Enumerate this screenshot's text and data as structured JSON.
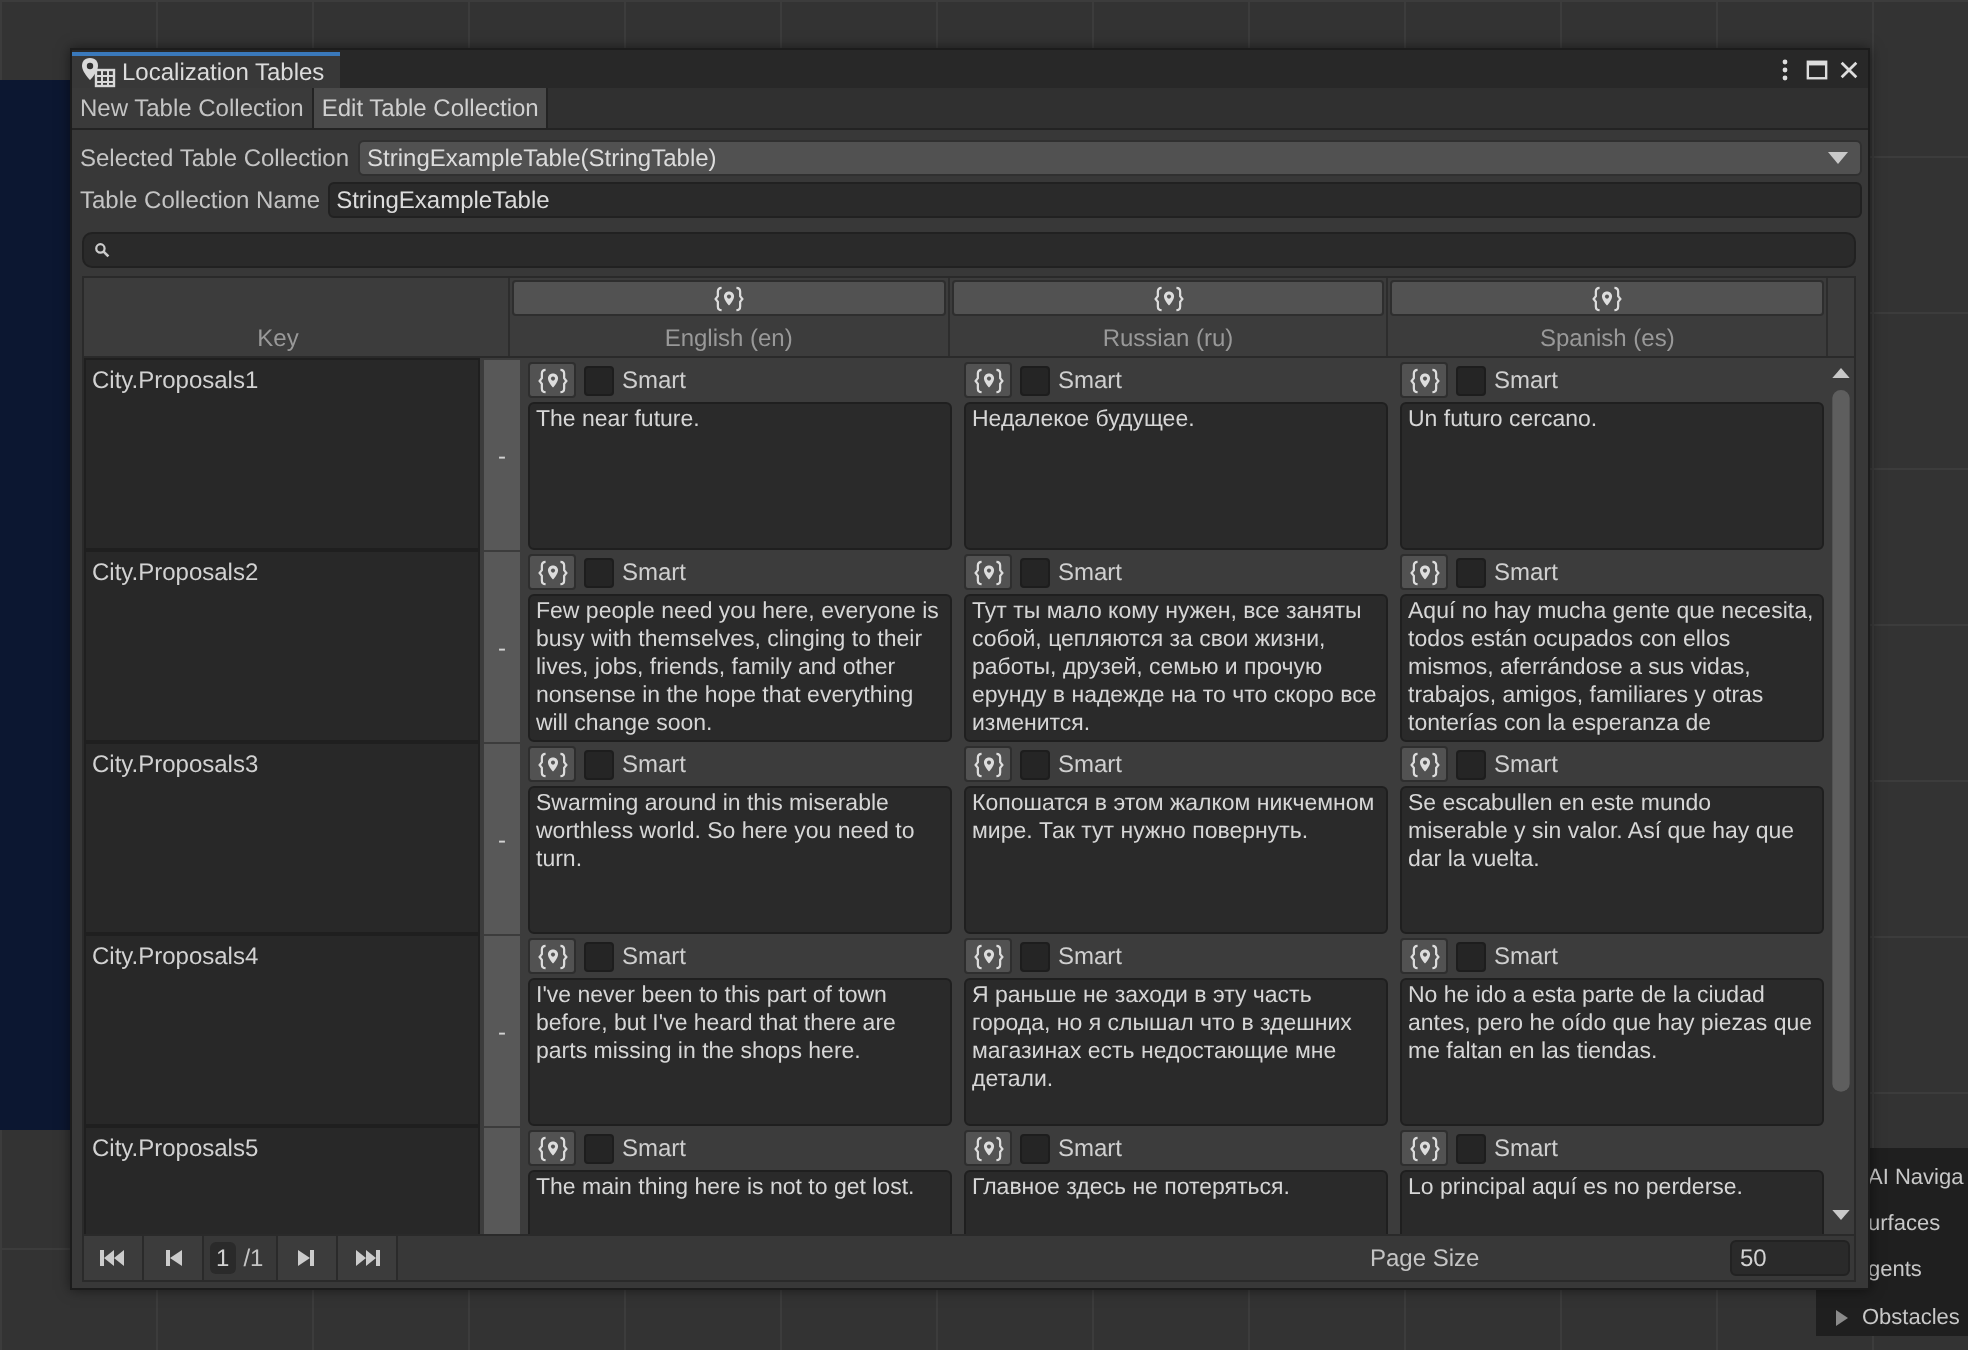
{
  "window": {
    "title": "Localization Tables"
  },
  "tabs": [
    {
      "label": "New Table Collection",
      "selected": false
    },
    {
      "label": "Edit Table Collection",
      "selected": true
    }
  ],
  "selected_table_collection": {
    "label": "Selected Table Collection",
    "value": "StringExampleTable(StringTable)"
  },
  "table_collection_name": {
    "label": "Table Collection Name",
    "value": "StringExampleTable"
  },
  "table": {
    "key_header": "Key",
    "columns": [
      "English (en)",
      "Russian (ru)",
      "Spanish (es)"
    ],
    "rows": [
      {
        "key": "City.Proposals1",
        "remove_label": "-",
        "entries": [
          {
            "smart": false,
            "smart_label": "Smart",
            "text": "The near future."
          },
          {
            "smart": false,
            "smart_label": "Smart",
            "text": "Недалекое будущее."
          },
          {
            "smart": false,
            "smart_label": "Smart",
            "text": "Un futuro cercano."
          }
        ]
      },
      {
        "key": "City.Proposals2",
        "remove_label": "-",
        "entries": [
          {
            "smart": false,
            "smart_label": "Smart",
            "text": "Few people need you here, everyone is busy with themselves, clinging to their lives, jobs, friends, family and other nonsense in the hope that everything will change soon."
          },
          {
            "smart": false,
            "smart_label": "Smart",
            "text": "Тут ты мало кому нужен, все заняты собой, цепляются за свои жизни, работы, друзей, семью и прочую ерунду в надежде на то что скоро все изменится."
          },
          {
            "smart": false,
            "smart_label": "Smart",
            "text": "Aquí no hay mucha gente que necesita, todos están ocupados con ellos mismos, aferrándose a sus vidas, trabajos, amigos, familiares y otras tonterías con la esperanza de"
          }
        ]
      },
      {
        "key": "City.Proposals3",
        "remove_label": "-",
        "entries": [
          {
            "smart": false,
            "smart_label": "Smart",
            "text": "Swarming around in this miserable worthless world. So here you need to turn."
          },
          {
            "smart": false,
            "smart_label": "Smart",
            "text": "Копошатся в этом жалком никчемном мире. Так тут нужно повернуть."
          },
          {
            "smart": false,
            "smart_label": "Smart",
            "text": "Se escabullen en este mundo miserable y sin valor. Así que hay que dar la vuelta."
          }
        ]
      },
      {
        "key": "City.Proposals4",
        "remove_label": "-",
        "entries": [
          {
            "smart": false,
            "smart_label": "Smart",
            "text": "I've never been to this part of town before, but I've heard that there are parts missing in the shops here."
          },
          {
            "smart": false,
            "smart_label": "Smart",
            "text": "Я раньше не заходи в эту часть города, но я слышал что в здешних магазинах есть недостающие мне детали."
          },
          {
            "smart": false,
            "smart_label": "Smart",
            "text": "No he ido a esta parte de la ciudad antes, pero he oído que hay piezas que me faltan en las tiendas."
          }
        ]
      },
      {
        "key": "City.Proposals5",
        "entries": [
          {
            "smart": false,
            "smart_label": "Smart",
            "text": "The main thing here is not to get lost."
          },
          {
            "smart": false,
            "smart_label": "Smart",
            "text": "Главное здесь не потеряться."
          },
          {
            "smart": false,
            "smart_label": "Smart",
            "text": "Lo principal aquí es no perderse."
          }
        ]
      }
    ]
  },
  "pagination": {
    "page": "1",
    "total": "/1",
    "page_size_label": "Page Size",
    "page_size": "50"
  },
  "navigation_panel": {
    "items": [
      {
        "kind": "label",
        "label": "AI Naviga"
      },
      {
        "kind": "label",
        "label": "urfaces"
      },
      {
        "kind": "label",
        "label": "gents"
      },
      {
        "kind": "foldout",
        "label": "Obstacles",
        "expanded": false
      }
    ]
  }
}
